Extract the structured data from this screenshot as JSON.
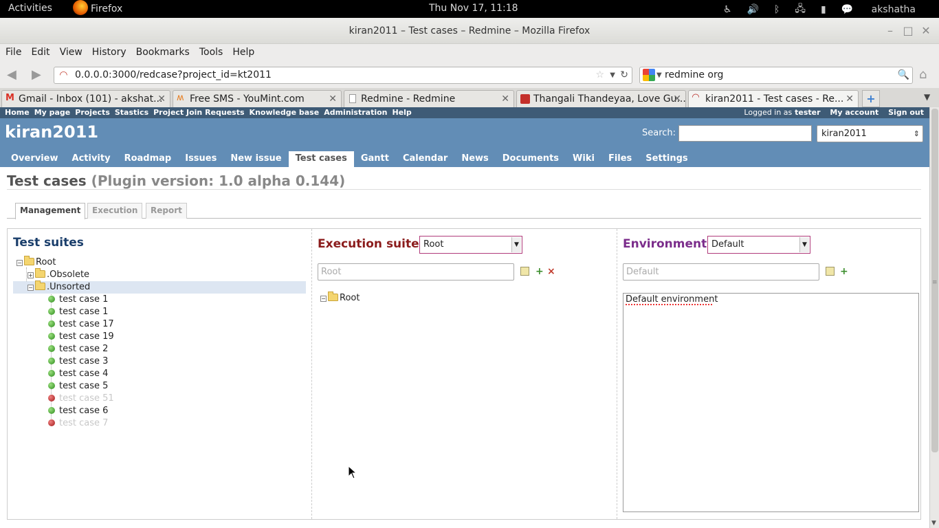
{
  "gnome": {
    "activities": "Activities",
    "app_name": "Firefox",
    "clock": "Thu Nov 17, 11:18",
    "user": "akshatha",
    "tray_icons": [
      "accessibility-icon",
      "volume-icon",
      "bluetooth-icon",
      "network-icon",
      "battery-icon",
      "chat-icon"
    ]
  },
  "window": {
    "title": "kiran2011 – Test cases – Redmine – Mozilla Firefox"
  },
  "menubar": [
    "File",
    "Edit",
    "View",
    "History",
    "Bookmarks",
    "Tools",
    "Help"
  ],
  "nav": {
    "url": "0.0.0.0:3000/redcase?project_id=kt2011",
    "search_value": "redmine org"
  },
  "tabs": [
    {
      "label": "Gmail - Inbox (101) - akshat...",
      "icon": "gmail-icon"
    },
    {
      "label": "Free SMS - YouMint.com",
      "icon": "youmint-icon"
    },
    {
      "label": "Redmine - Redmine",
      "icon": "page-icon"
    },
    {
      "label": "Thangali Thandeyaa, Love Gu...",
      "icon": "youtube-icon"
    },
    {
      "label": "kiran2011 - Test cases - Re...",
      "icon": "redmine-icon"
    }
  ],
  "redmine": {
    "top_menu": [
      "Home",
      "My page",
      "Projects",
      "Stastics",
      "Project Join Requests",
      "Knowledge base",
      "Administration",
      "Help"
    ],
    "logged_in_as": "Logged in as",
    "user": "tester",
    "my_account": "My account",
    "sign_out": "Sign out",
    "project_title": "kiran2011",
    "search_label": "Search:",
    "project_select": "kiran2011",
    "main_menu": [
      "Overview",
      "Activity",
      "Roadmap",
      "Issues",
      "New issue",
      "Test cases",
      "Gantt",
      "Calendar",
      "News",
      "Documents",
      "Wiki",
      "Files",
      "Settings"
    ],
    "main_menu_selected": "Test cases",
    "page_title": "Test cases",
    "plugin_version": "(Plugin version: 1.0 alpha 0.144)",
    "subtabs": [
      "Management",
      "Execution",
      "Report"
    ],
    "test_suites": {
      "title": "Test suites",
      "root": "Root",
      "obsolete": ".Obsolete",
      "unsorted": ".Unsorted",
      "cases": [
        {
          "label": "test case 1",
          "status": "green"
        },
        {
          "label": "test case 1",
          "status": "green"
        },
        {
          "label": "test case 17",
          "status": "green"
        },
        {
          "label": "test case 19",
          "status": "green"
        },
        {
          "label": "test case 2",
          "status": "green"
        },
        {
          "label": "test case 3",
          "status": "green"
        },
        {
          "label": "test case 4",
          "status": "green"
        },
        {
          "label": "test case 5",
          "status": "green"
        },
        {
          "label": "test case 51",
          "status": "red"
        },
        {
          "label": "test case 6",
          "status": "green"
        },
        {
          "label": "test case 7",
          "status": "red"
        }
      ]
    },
    "execution": {
      "title": "Execution suite:",
      "selected": "Root",
      "input_placeholder": "Root",
      "tree_root": "Root"
    },
    "environment": {
      "title": "Environment:",
      "selected": "Default",
      "input_placeholder": "Default",
      "description": "Default environment"
    }
  }
}
